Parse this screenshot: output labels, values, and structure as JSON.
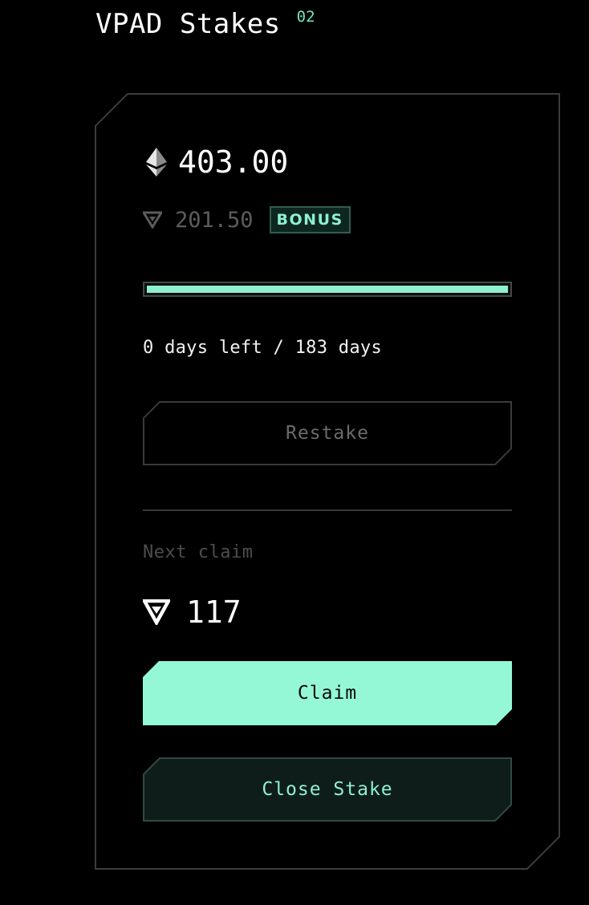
{
  "header": {
    "title": "VPAD Stakes",
    "count": "02"
  },
  "stake_card": {
    "amount": "403.00",
    "amount_icon": "ethereum-icon",
    "bonus_amount": "201.50",
    "bonus_icon": "vpad-token-icon",
    "bonus_badge": "BONUS",
    "progress_fraction": 1.0,
    "days_text": "0 days left / 183 days",
    "restake_label": "Restake",
    "next_claim_label": "Next claim",
    "next_claim_amount": "117",
    "next_claim_icon": "vpad-token-icon",
    "claim_label": "Claim",
    "close_stake_label": "Close Stake"
  },
  "colors": {
    "background": "#000000",
    "accent": "#94f8d6",
    "muted_text": "#5c5c5c",
    "frame_border": "#3c3c3c",
    "close_button_bg": "#0f1d1a"
  }
}
